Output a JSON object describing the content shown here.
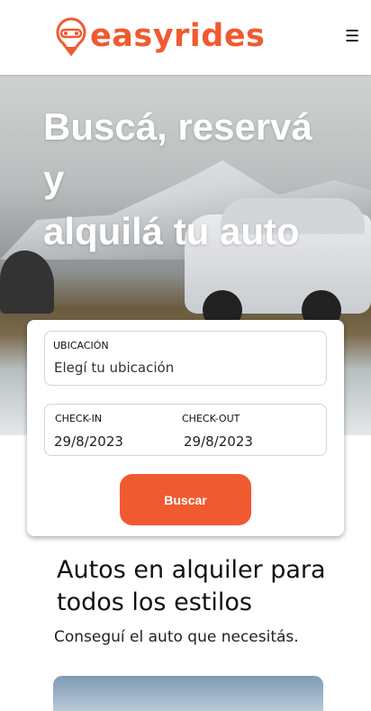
{
  "header": {
    "brand": "easyrides",
    "menu_icon": "hamburger-icon",
    "brand_color": "#f05a30"
  },
  "hero": {
    "title": "Buscá, reservá\ny\nalquilá tu auto"
  },
  "search": {
    "location_label": "UBICACIÓN",
    "location_placeholder": "Elegí tu ubicación",
    "checkin_label": "CHECK-IN",
    "checkin_value": "29/8/2023",
    "checkout_label": "CHECK-OUT",
    "checkout_value": "29/8/2023",
    "button": "Buscar"
  },
  "section": {
    "title": "Autos en alquiler para todos los estilos",
    "subtitle": "Conseguí el auto que necesitás."
  }
}
